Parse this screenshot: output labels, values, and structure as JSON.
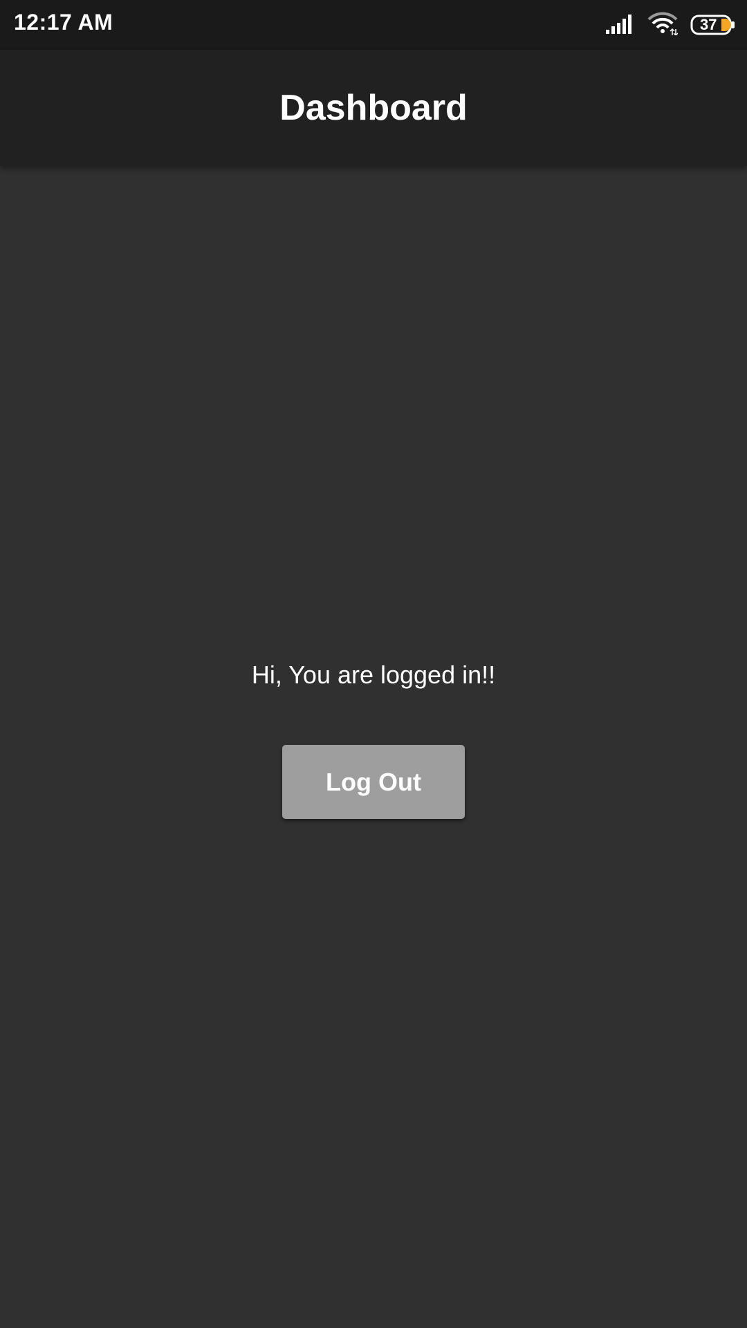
{
  "status_bar": {
    "time": "12:17 AM",
    "battery_level": "37",
    "battery_fill_color": "#f5a623",
    "icons": [
      "signal-icon",
      "wifi-icon",
      "battery-icon"
    ]
  },
  "app_bar": {
    "title": "Dashboard",
    "background_color": "#212121"
  },
  "main": {
    "greeting": "Hi, You are logged in!!",
    "logout_label": "Log Out",
    "background_color": "#303030",
    "button_color": "#9e9e9e"
  }
}
